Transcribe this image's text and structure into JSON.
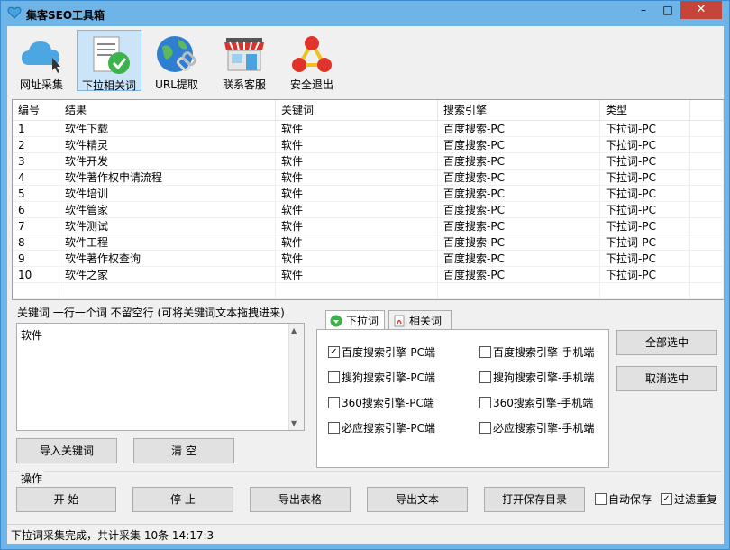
{
  "window": {
    "title": "集客SEO工具箱",
    "minimize": "–",
    "maximize": "□",
    "close": "✕"
  },
  "toolbar": [
    {
      "label": "网址采集",
      "icon": "cloud-cursor-icon"
    },
    {
      "label": "下拉相关词",
      "icon": "document-check-icon",
      "active": true
    },
    {
      "label": "URL提取",
      "icon": "globe-link-icon"
    },
    {
      "label": "联系客服",
      "icon": "shop-icon"
    },
    {
      "label": "安全退出",
      "icon": "exit-nodes-icon"
    }
  ],
  "table": {
    "columns": [
      "编号",
      "结果",
      "关键词",
      "搜索引擎",
      "类型"
    ],
    "rows": [
      [
        "1",
        "软件下载",
        "软件",
        "百度搜索-PC",
        "下拉词-PC"
      ],
      [
        "2",
        "软件精灵",
        "软件",
        "百度搜索-PC",
        "下拉词-PC"
      ],
      [
        "3",
        "软件开发",
        "软件",
        "百度搜索-PC",
        "下拉词-PC"
      ],
      [
        "4",
        "软件著作权申请流程",
        "软件",
        "百度搜索-PC",
        "下拉词-PC"
      ],
      [
        "5",
        "软件培训",
        "软件",
        "百度搜索-PC",
        "下拉词-PC"
      ],
      [
        "6",
        "软件管家",
        "软件",
        "百度搜索-PC",
        "下拉词-PC"
      ],
      [
        "7",
        "软件测试",
        "软件",
        "百度搜索-PC",
        "下拉词-PC"
      ],
      [
        "8",
        "软件工程",
        "软件",
        "百度搜索-PC",
        "下拉词-PC"
      ],
      [
        "9",
        "软件著作权查询",
        "软件",
        "百度搜索-PC",
        "下拉词-PC"
      ],
      [
        "10",
        "软件之家",
        "软件",
        "百度搜索-PC",
        "下拉词-PC"
      ]
    ]
  },
  "keywords": {
    "legend": "关键词 一行一个词 不留空行 (可将关键词文本拖拽进来)",
    "value": "软件",
    "import_button": "导入关键词",
    "clear_button": "清 空"
  },
  "tabs": {
    "items": [
      {
        "label": "下拉词",
        "active": true,
        "icon": "down-arrow-circle-icon"
      },
      {
        "label": "相关词",
        "active": false,
        "icon": "pdf-icon"
      }
    ],
    "options": [
      {
        "label": "百度搜索引擎-PC端",
        "checked": true
      },
      {
        "label": "百度搜索引擎-手机端",
        "checked": false
      },
      {
        "label": "搜狗搜索引擎-PC端",
        "checked": false
      },
      {
        "label": "搜狗搜索引擎-手机端",
        "checked": false
      },
      {
        "label": "360搜索引擎-PC端",
        "checked": false
      },
      {
        "label": "360搜索引擎-手机端",
        "checked": false
      },
      {
        "label": "必应搜索引擎-PC端",
        "checked": false
      },
      {
        "label": "必应搜索引擎-手机端",
        "checked": false
      }
    ],
    "select_all": "全部选中",
    "deselect_all": "取消选中"
  },
  "operations": {
    "legend": "操作",
    "start": "开 始",
    "stop": "停 止",
    "export_table": "导出表格",
    "export_text": "导出文本",
    "open_dir": "打开保存目录",
    "auto_save": {
      "label": "自动保存",
      "checked": false
    },
    "filter_dup": {
      "label": "过滤重复",
      "checked": true
    }
  },
  "status": {
    "text": "下拉词采集完成，共计采集 10条 14:17:3"
  }
}
